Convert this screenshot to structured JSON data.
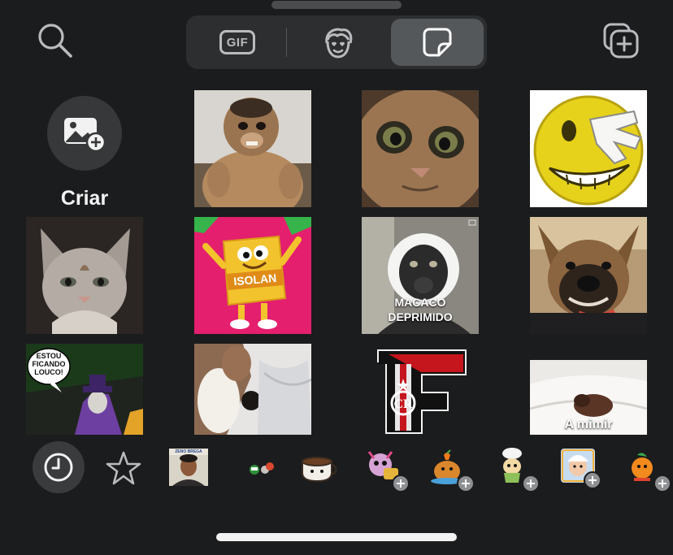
{
  "header": {
    "tabs": [
      {
        "label": "GIF",
        "icon": "gif-icon"
      },
      {
        "label": "",
        "icon": "emoji-face-icon"
      },
      {
        "label": "",
        "icon": "sticker-icon",
        "selected": true
      }
    ]
  },
  "create": {
    "label": "Criar",
    "icon": "add-image-icon"
  },
  "stickers": [
    {
      "name": "monkey"
    },
    {
      "name": "cat-closeup"
    },
    {
      "name": "yellow-emoji-facepalm"
    },
    {
      "name": "grey-cat"
    },
    {
      "name": "isolan-mascot",
      "text": "ISOLAN"
    },
    {
      "name": "gibbon",
      "caption": "MACACO\nDEPRIMIDO"
    },
    {
      "name": "dog-smiling"
    },
    {
      "name": "comic-joker",
      "text": "ESTOU FICANDO LOUCO!"
    },
    {
      "name": "puppy-blanket"
    },
    {
      "name": "flamengo-logo"
    },
    {
      "name": "dog-sleeping",
      "caption": "A mimir"
    }
  ],
  "bottom_bar": {
    "items": [
      {
        "name": "recent-icon",
        "selected": true
      },
      {
        "name": "favorites-star-icon"
      },
      {
        "name": "pack-man-portrait",
        "text": "ZENO BREGA"
      },
      {
        "name": "pack-tiny-emoji"
      },
      {
        "name": "pack-coffee-cup"
      },
      {
        "name": "pack-cartoon-animal",
        "add": true
      },
      {
        "name": "pack-capybara",
        "add": true
      },
      {
        "name": "pack-cook-character",
        "add": true
      },
      {
        "name": "pack-baby-photo",
        "add": true
      },
      {
        "name": "pack-orange-character",
        "add": true
      }
    ]
  },
  "colors": {
    "background": "#1b1c1d",
    "tab_bg": "#2c2e30",
    "tab_selected": "#55585b",
    "text": "#f1f1f2"
  }
}
